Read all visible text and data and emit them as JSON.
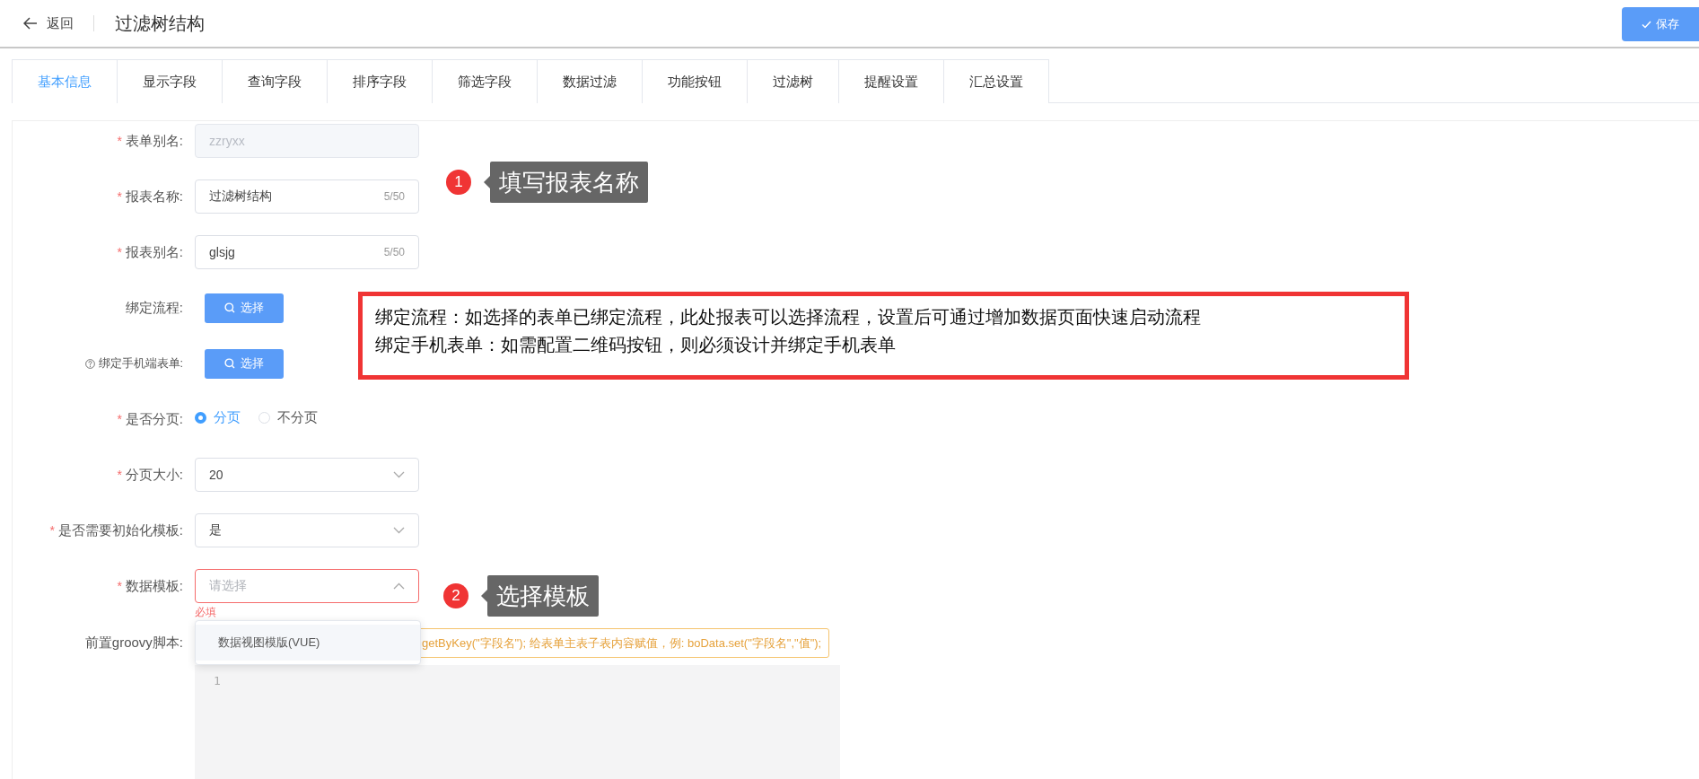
{
  "header": {
    "back_label": "返回",
    "title": "过滤树结构",
    "save_label": "保存"
  },
  "tabs": [
    {
      "label": "基本信息",
      "selected": true
    },
    {
      "label": "显示字段",
      "selected": false
    },
    {
      "label": "查询字段",
      "selected": false
    },
    {
      "label": "排序字段",
      "selected": false
    },
    {
      "label": "筛选字段",
      "selected": false
    },
    {
      "label": "数据过滤",
      "selected": false
    },
    {
      "label": "功能按钮",
      "selected": false
    },
    {
      "label": "过滤树",
      "selected": false
    },
    {
      "label": "提醒设置",
      "selected": false
    },
    {
      "label": "汇总设置",
      "selected": false
    }
  ],
  "fields": [
    {
      "kind": "input",
      "required_mark": "*",
      "label": "表单别名:",
      "value": "zzryxx",
      "disabled": true
    },
    {
      "kind": "input",
      "required_mark": "*",
      "label": "报表名称:",
      "value": "过滤树结构",
      "counter": "5/50",
      "disabled": false
    },
    {
      "kind": "input",
      "required_mark": "*",
      "label": "报表别名:",
      "value": "glsjg",
      "counter": "5/50",
      "disabled": false
    },
    {
      "kind": "button",
      "label": "绑定流程:",
      "button_label": "选择",
      "help": false
    },
    {
      "kind": "button",
      "label": "绑定手机端表单:",
      "button_label": "选择",
      "help": true
    },
    {
      "kind": "radio",
      "required_mark": "*",
      "label": "是否分页:",
      "options": [
        {
          "label": "分页",
          "selected": true
        },
        {
          "label": "不分页",
          "selected": false
        }
      ]
    },
    {
      "kind": "select",
      "required_mark": "*",
      "label": "分页大小:",
      "value": "20",
      "open": false
    },
    {
      "kind": "select",
      "required_mark": "*",
      "label": "是否需要初始化模板:",
      "value": "是",
      "open": false
    },
    {
      "kind": "select",
      "required_mark": "*",
      "label": "数据模板:",
      "placeholder": "请选择",
      "open": true,
      "error": "必填",
      "options": [
        "数据视图模版(VUE)"
      ]
    }
  ],
  "groovy": {
    "label": "前置groovy脚本:",
    "hint": "getByKey(\"字段名\"); 给表单主表子表内容赋值，例: boData.set(\"字段名\",\"值\");",
    "line_numbers": [
      "1"
    ]
  },
  "callouts": [
    {
      "number": "1",
      "text": "填写报表名称"
    },
    {
      "number": "2",
      "text": "选择模板"
    }
  ],
  "note_box": {
    "lines": [
      "绑定流程：如选择的表单已绑定流程，此处报表可以选择流程，设置后可通过增加数据页面快速启动流程",
      "绑定手机表单：如需配置二维码按钮，则必须设计并绑定手机表单"
    ]
  }
}
